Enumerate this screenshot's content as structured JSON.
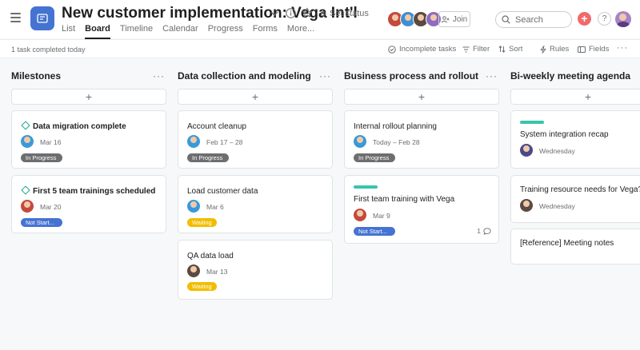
{
  "project": {
    "title": "New customer implementation: Vega Int'l",
    "set_status": "Set status",
    "icon": "board-icon",
    "color": "#4573d2"
  },
  "tabs": [
    "List",
    "Board",
    "Timeline",
    "Calendar",
    "Progress",
    "Forms",
    "More..."
  ],
  "header": {
    "join_label": "Join",
    "search_placeholder": "Search",
    "help_label": "?"
  },
  "subbar": {
    "completed_text": "1 task completed today",
    "incomplete_tasks": "Incomplete tasks",
    "filter": "Filter",
    "sort": "Sort",
    "rules": "Rules",
    "fields": "Fields"
  },
  "columns": [
    {
      "title": "Milestones",
      "cards": [
        {
          "title": "Data migration complete",
          "milestone": true,
          "due": "Mar 16",
          "status": "In Progress",
          "status_color": "#6d6e6f"
        },
        {
          "title": "First 5 team trainings scheduled",
          "milestone": true,
          "due": "Mar 20",
          "status": "Not Start...",
          "status_color": "#4573d2"
        }
      ]
    },
    {
      "title": "Data collection and modeling",
      "cards": [
        {
          "title": "Account cleanup",
          "due": "Feb 17 – 28",
          "status": "In Progress",
          "status_color": "#6d6e6f"
        },
        {
          "title": "Load customer data",
          "due": "Mar 6",
          "status": "Waiting",
          "status_color": "#f1bd00"
        },
        {
          "title": "QA data load",
          "due": "Mar 13",
          "status": "Waiting",
          "status_color": "#f1bd00"
        }
      ]
    },
    {
      "title": "Business process and rollout",
      "cards": [
        {
          "title": "Internal rollout planning",
          "due": "Today – Feb 28",
          "status": "In Progress",
          "status_color": "#6d6e6f"
        },
        {
          "title": "First team training with Vega",
          "due": "Mar 9",
          "status": "Not Start...",
          "status_color": "#4573d2",
          "comments": "1",
          "tag_color": "#37c5ab"
        }
      ]
    },
    {
      "title": "Bi-weekly meeting agenda",
      "cards": [
        {
          "title": "System integration recap",
          "due": "Wednesday",
          "tag_color": "#37c5ab"
        },
        {
          "title": "Training resource needs for Vega?",
          "due": "Wednesday"
        },
        {
          "title": "[Reference] Meeting notes"
        }
      ]
    }
  ],
  "add_label": "+",
  "more_label": "···"
}
